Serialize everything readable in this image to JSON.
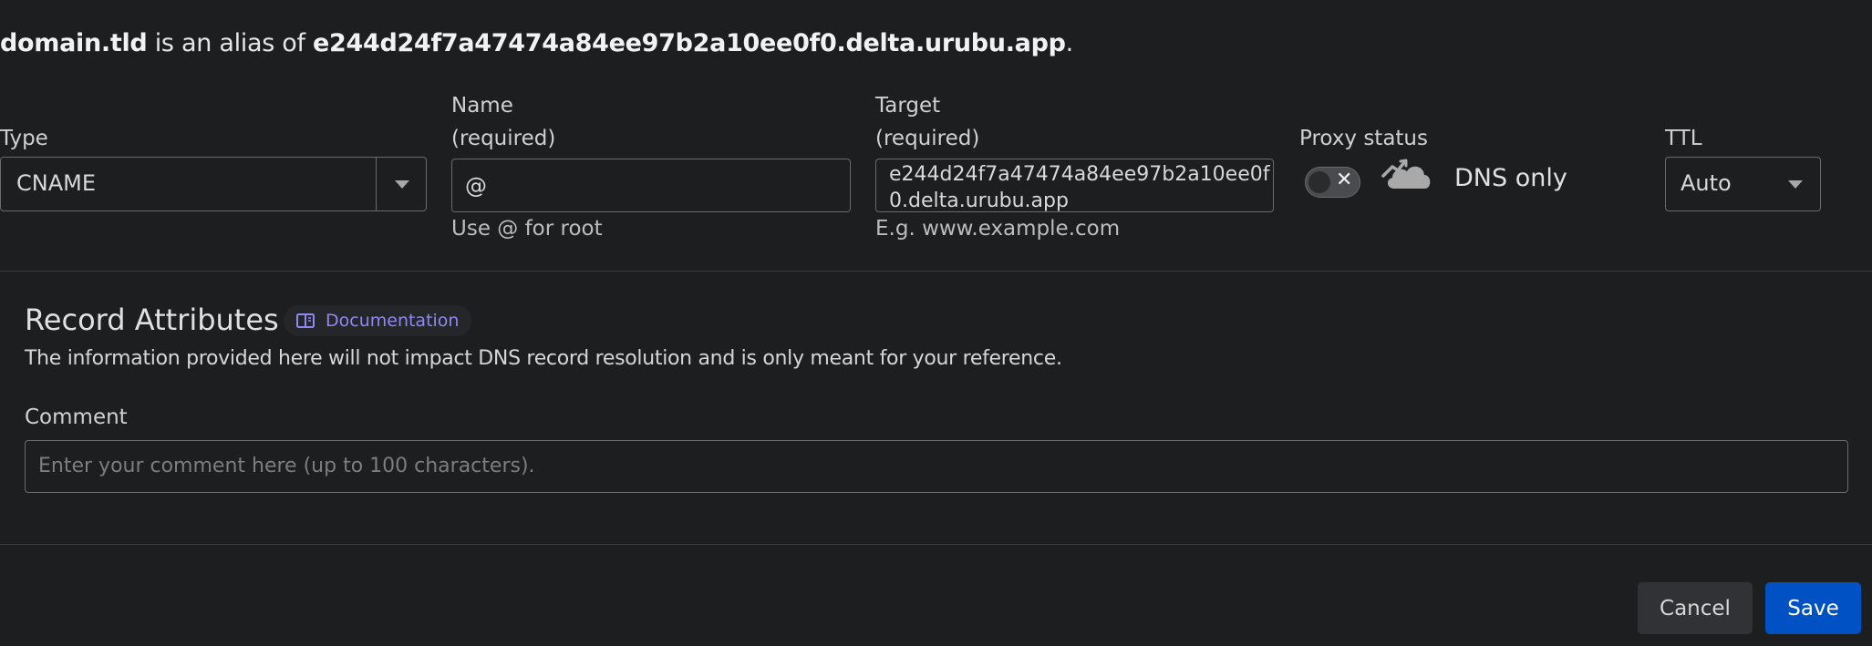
{
  "summary": {
    "domain": "domain.tld",
    "middle": " is an alias of ",
    "target": "e244d24f7a47474a84ee97b2a10ee0f0.delta.urubu.app",
    "end": "."
  },
  "type_field": {
    "label": "Type",
    "value": "CNAME"
  },
  "name_field": {
    "label": "Name",
    "required": "(required)",
    "value": "@",
    "hint": "Use @ for root"
  },
  "target_field": {
    "label": "Target",
    "required": "(required)",
    "value_line1": "e244d24f7a47474a84ee97b2a10ee0f",
    "value_line2": "0.delta.urubu.app",
    "hint": "E.g. www.example.com"
  },
  "proxy": {
    "label": "Proxy status",
    "status_text": "DNS only",
    "enabled": false
  },
  "ttl_field": {
    "label": "TTL",
    "value": "Auto"
  },
  "attributes": {
    "title": "Record Attributes",
    "doc_link": "Documentation",
    "description": "The information provided here will not impact DNS record resolution and is only meant for your reference."
  },
  "comment": {
    "label": "Comment",
    "placeholder": "Enter your comment here (up to 100 characters)."
  },
  "actions": {
    "cancel": "Cancel",
    "save": "Save"
  },
  "colors": {
    "background": "#1d1e20",
    "accent": "#0051c3",
    "link": "#8e88f0"
  }
}
